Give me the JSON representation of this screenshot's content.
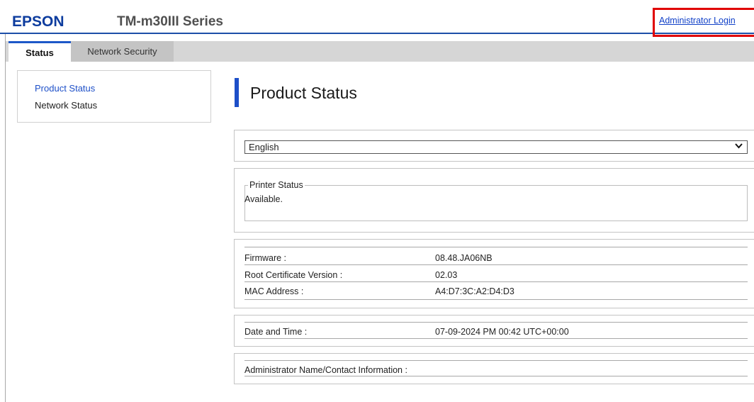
{
  "header": {
    "brand": "EPSON",
    "model": "TM-m30III Series",
    "admin_login": "Administrator Login"
  },
  "tabs": [
    {
      "label": "Status",
      "active": true
    },
    {
      "label": "Network Security",
      "active": false
    }
  ],
  "sidebar": {
    "items": [
      {
        "label": "Product Status",
        "active": true
      },
      {
        "label": "Network Status",
        "active": false
      }
    ]
  },
  "main": {
    "title": "Product Status",
    "language": {
      "selected": "English"
    },
    "printer_status": {
      "legend": "Printer Status",
      "value": "Available."
    },
    "info_rows": [
      {
        "label": "Firmware :",
        "value": "08.48.JA06NB"
      },
      {
        "label": "Root Certificate Version :",
        "value": "02.03"
      },
      {
        "label": "MAC Address :",
        "value": "A4:D7:3C:A2:D4:D3"
      }
    ],
    "date_time": {
      "label": "Date and Time :",
      "value": "07-09-2024 PM 00:42 UTC+00:00"
    },
    "admin_contact": {
      "label": "Administrator Name/Contact Information :",
      "value": ""
    }
  },
  "colors": {
    "brand": "#0d3c9e",
    "accent": "#1d4fc8",
    "link": "#1040c8",
    "highlight_box": "#e00000"
  }
}
